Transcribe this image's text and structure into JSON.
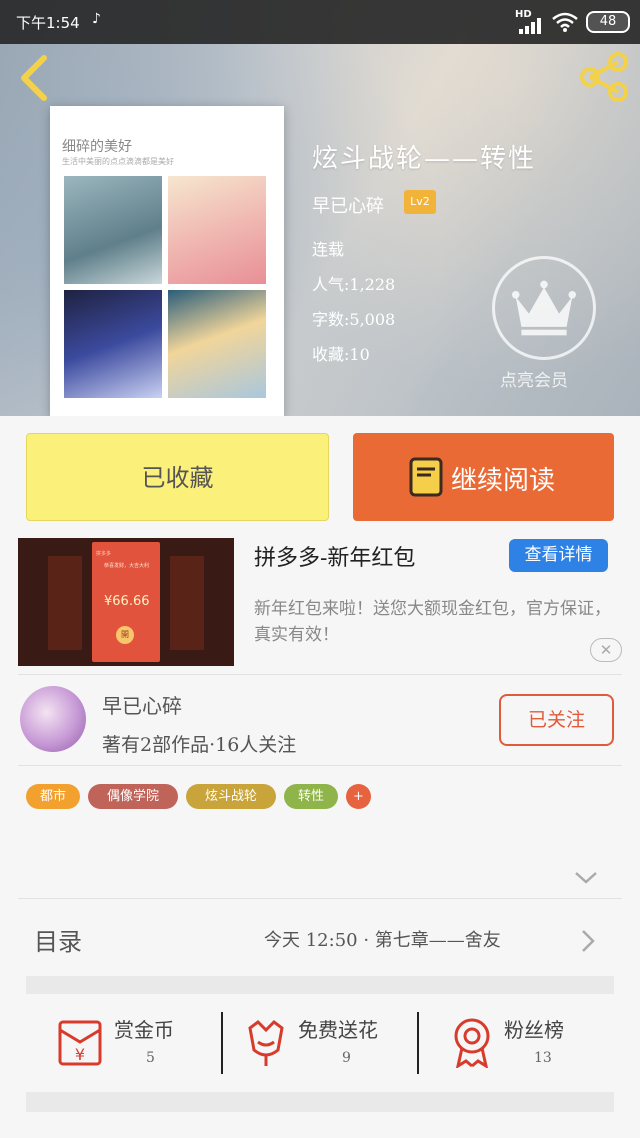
{
  "status_bar": {
    "time": "下午1:54",
    "network": "HD",
    "battery": "48"
  },
  "book": {
    "title": "炫斗战轮——转性",
    "author": "早已心碎",
    "level": "Lv2",
    "status": "连载",
    "popularity": "人气:1,228",
    "word_count": "字数:5,008",
    "favorites": "收藏:10",
    "cover_title": "细碎的美好",
    "cover_subtitle": "生活中美丽的点点滴滴都是美好"
  },
  "vip": {
    "label": "点亮会员"
  },
  "buttons": {
    "collected": "已收藏",
    "continue_reading": "继续阅读"
  },
  "ad": {
    "title": "拼多多-新年红包",
    "detail_label": "查看详情",
    "description": "新年红包来啦！送您大额现金红包，官方保证，真实有效！",
    "image_brand": "拼多多",
    "image_tip": "恭喜发财，大吉大利",
    "image_money": "¥66.66",
    "image_open": "開",
    "close_label": "✕"
  },
  "author_card": {
    "name": "早已心碎",
    "stats": "著有2部作品·16人关注",
    "follow_label": "已关注"
  },
  "tags": [
    "都市",
    "偶像学院",
    "炫斗战轮",
    "转性",
    "+"
  ],
  "tag_colors": [
    "#f2a12f",
    "#c0645a",
    "#c9a43a",
    "#8fb44a",
    "#e7623e"
  ],
  "catalog": {
    "label": "目录",
    "latest": "今天 12:50 · 第七章——舍友"
  },
  "actions": [
    {
      "label": "赏金币",
      "count": "5",
      "icon": "red-envelope-icon"
    },
    {
      "label": "免费送花",
      "count": "9",
      "icon": "flower-icon"
    },
    {
      "label": "粉丝榜",
      "count": "13",
      "icon": "medal-icon"
    }
  ],
  "colors": {
    "accent_orange": "#ea6a36",
    "collected_yellow": "#fbf07a",
    "icon_red": "#d63b2c",
    "detail_blue": "#2e82e6"
  }
}
